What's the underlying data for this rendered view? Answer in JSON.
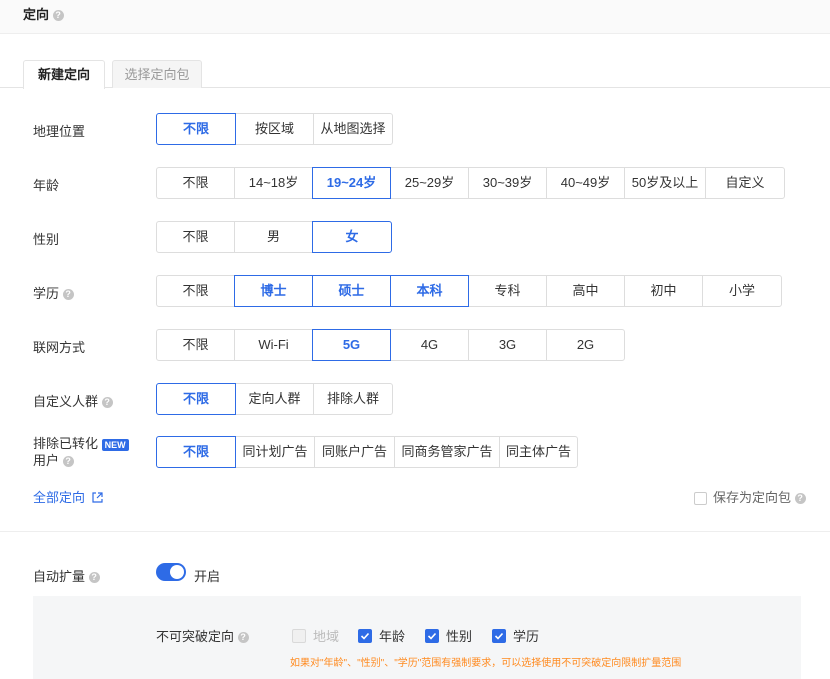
{
  "header": {
    "title": "定向"
  },
  "tabs": [
    {
      "label": "新建定向",
      "active": true
    },
    {
      "label": "选择定向包",
      "active": false
    }
  ],
  "rows": [
    {
      "label": "地理位置",
      "options": [
        "不限",
        "按区域",
        "从地图选择"
      ]
    },
    {
      "label": "年龄",
      "options": [
        "不限",
        "14~18岁",
        "19~24岁",
        "25~29岁",
        "30~39岁",
        "40~49岁",
        "50岁及以上",
        "自定义"
      ]
    },
    {
      "label": "性别",
      "options": [
        "不限",
        "男",
        "女"
      ]
    },
    {
      "label": "学历",
      "options": [
        "不限",
        "博士",
        "硕士",
        "本科",
        "专科",
        "高中",
        "初中",
        "小学"
      ]
    },
    {
      "label": "联网方式",
      "options": [
        "不限",
        "Wi-Fi",
        "5G",
        "4G",
        "3G",
        "2G"
      ]
    },
    {
      "label": "自定义人群",
      "options": [
        "不限",
        "定向人群",
        "排除人群"
      ]
    },
    {
      "label": "排除已转化",
      "label2": "用户",
      "badge": "NEW",
      "options": [
        "不限",
        "同计划广告",
        "同账户广告",
        "同商务管家广告",
        "同主体广告"
      ]
    }
  ],
  "footer": {
    "all_targeting": "全部定向",
    "save_as_package": "保存为定向包"
  },
  "auto_expand": {
    "label": "自动扩量",
    "toggle_text": "开启",
    "enabled": true
  },
  "non_breakable": {
    "label": "不可突破定向",
    "options": [
      {
        "label": "地域",
        "checked": false,
        "disabled": true
      },
      {
        "label": "年龄",
        "checked": true,
        "disabled": false
      },
      {
        "label": "性别",
        "checked": true,
        "disabled": false
      },
      {
        "label": "学历",
        "checked": true,
        "disabled": false
      }
    ],
    "hint": "如果对\"年龄\"、\"性别\"、\"学历\"范围有强制要求，可以选择使用不可突破定向限制扩量范围"
  },
  "colors": {
    "accent": "#2e6be6",
    "hint": "#ff8a1f"
  },
  "icons": {
    "help": "question-circle-icon",
    "external": "external-link-icon",
    "check": "check-icon"
  }
}
